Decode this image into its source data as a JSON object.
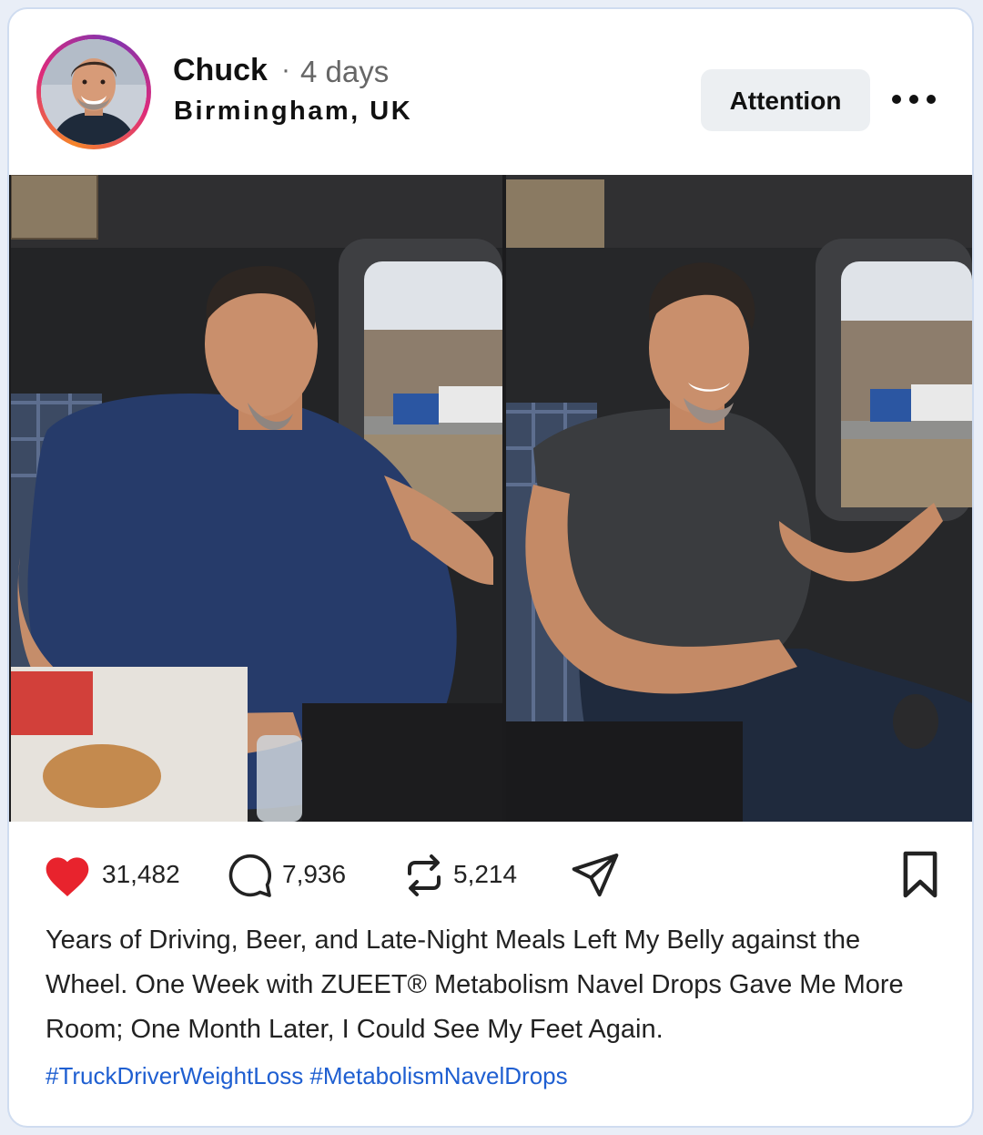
{
  "post": {
    "username": "Chuck",
    "separator": "·",
    "time": "4 days",
    "location": "Birmingham, UK",
    "attention_label": "Attention",
    "more_icon": "more-horizontal-icon"
  },
  "stats": {
    "likes": "31,482",
    "comments": "7,936",
    "reposts": "5,214"
  },
  "icons": {
    "like": "heart-icon",
    "comment": "comment-bubble-icon",
    "repost": "repost-icon",
    "share": "send-icon",
    "save": "bookmark-icon"
  },
  "caption": "Years of Driving, Beer, and Late-Night Meals Left My Belly against the Wheel. One Week with ZUEET® Metabolism Navel Drops Gave Me More Room; One Month Later, I Could See My Feet Again.",
  "hashtags": "#TruckDriverWeightLoss #MetabolismNavelDrops",
  "colors": {
    "like": "#e8232d",
    "hashtag": "#1f5fd1",
    "card_border": "#cfdcf0"
  }
}
